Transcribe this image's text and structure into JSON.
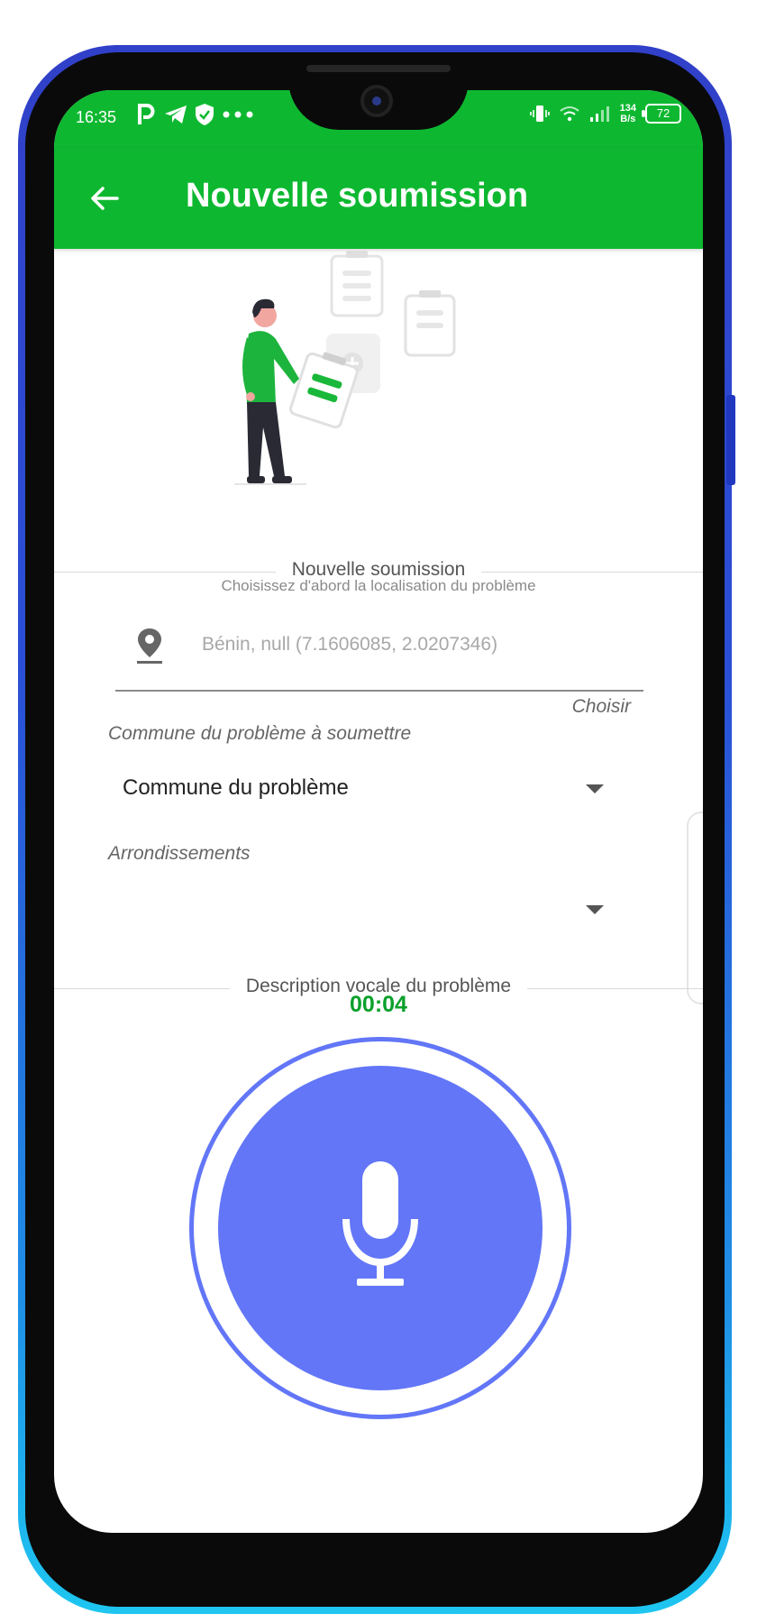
{
  "status_bar": {
    "time": "16:35",
    "net_speed_value": "134",
    "net_speed_unit": "B/s",
    "battery": "72",
    "icons_left": [
      "parking-icon",
      "telegram-icon",
      "shield-check-icon",
      "more-dots-icon"
    ],
    "icons_right": [
      "vibrate-icon",
      "wifi-icon",
      "signal-icon",
      "battery-icon"
    ]
  },
  "app_bar": {
    "title": "Nouvelle soumission",
    "back_icon": "back-arrow-icon"
  },
  "section_location": {
    "title": "Nouvelle soumission",
    "subtitle": "Choisissez d'abord la localisation du problème",
    "location_value": "Bénin, null (7.1606085, 2.0207346)",
    "choose_label": "Choisir"
  },
  "commune": {
    "label": "Commune du problème à soumettre",
    "selected": "Commune du problème"
  },
  "arrondissements": {
    "label": "Arrondissements",
    "selected": ""
  },
  "voice": {
    "title": "Description vocale du problème",
    "timer": "00:04"
  },
  "colors": {
    "primary_green": "#0db830",
    "timer_green": "#0aa02a",
    "mic_blue": "#6276f7"
  }
}
